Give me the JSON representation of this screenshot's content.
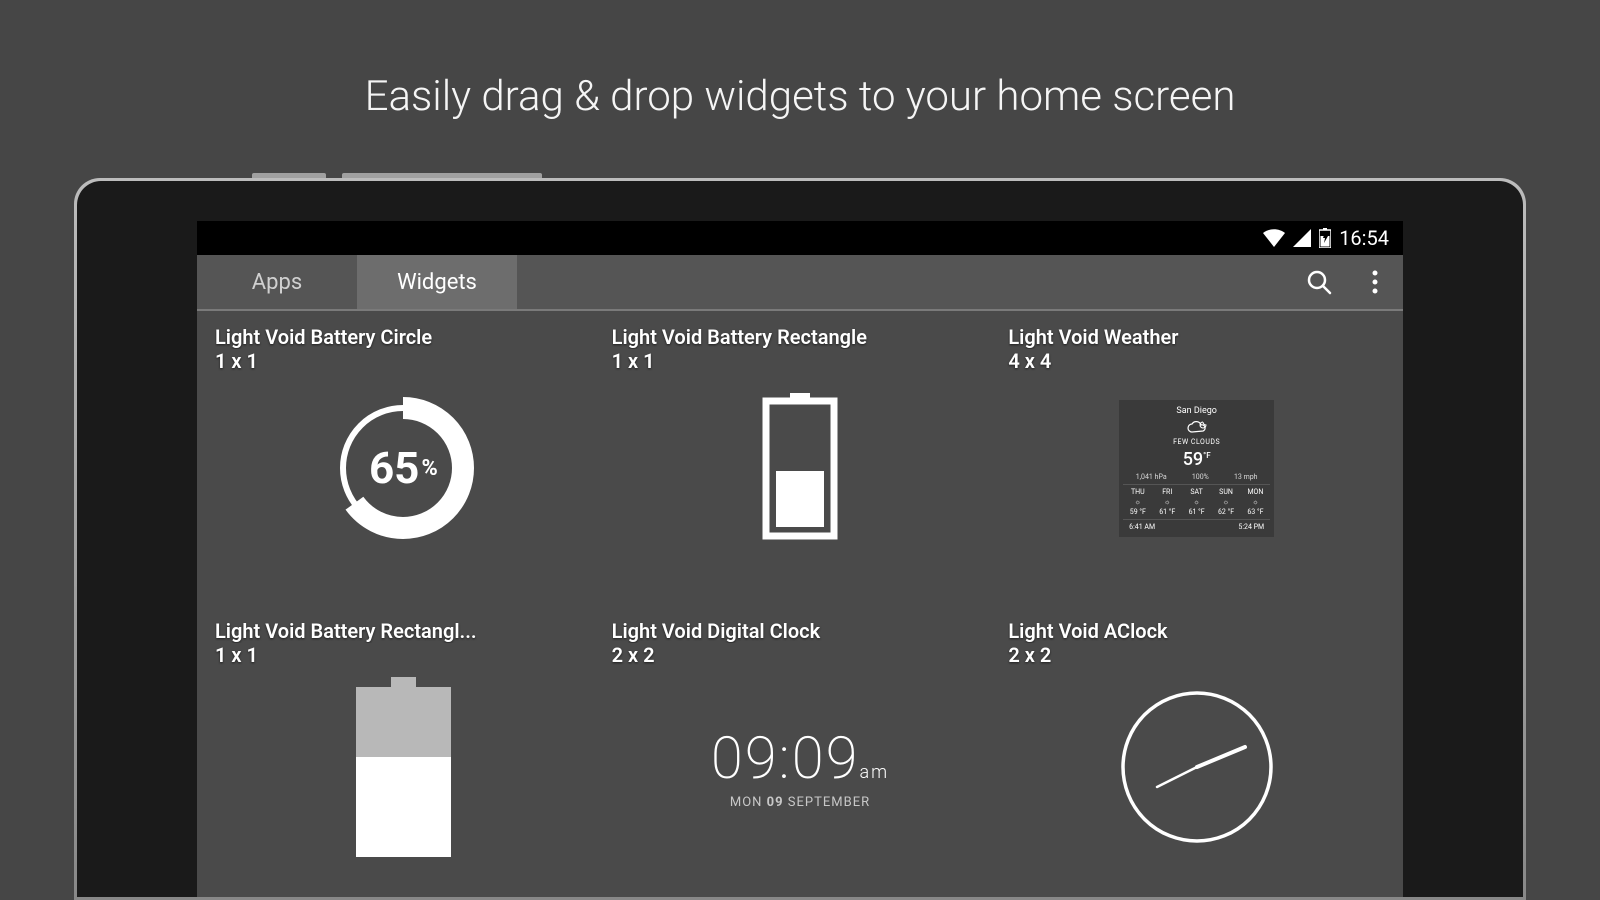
{
  "headline": "Easily drag & drop widgets to your home screen",
  "status_bar": {
    "time": "16:54"
  },
  "tabs": {
    "apps": "Apps",
    "widgets": "Widgets"
  },
  "widgets": [
    {
      "title": "Light Void Battery Circle",
      "size": "1 x 1",
      "type": "battery_circle",
      "value": "65",
      "unit": "%"
    },
    {
      "title": "Light Void Battery Rectangle",
      "size": "1 x 1",
      "type": "battery_rect_outline"
    },
    {
      "title": "Light Void Weather",
      "size": "4 x 4",
      "type": "weather",
      "city": "San Diego",
      "desc": "FEW CLOUDS",
      "temp": "59",
      "unit": "°F",
      "pressure": "1,041 hPa",
      "humidity": "100%",
      "wind": "13 mph",
      "days": [
        {
          "d": "THU",
          "t": "59 °F"
        },
        {
          "d": "FRI",
          "t": "61 °F"
        },
        {
          "d": "SAT",
          "t": "61 °F"
        },
        {
          "d": "SUN",
          "t": "62 °F"
        },
        {
          "d": "MON",
          "t": "63 °F"
        }
      ],
      "sunrise": "6:41 AM",
      "sunset": "5:24 PM"
    },
    {
      "title": "Light Void Battery Rectangl...",
      "size": "1 x 1",
      "type": "battery_rect_filled"
    },
    {
      "title": "Light Void Digital Clock",
      "size": "2 x 2",
      "type": "digital_clock",
      "time": "09:09",
      "ampm": "am",
      "date_pre": "MON ",
      "date_bold": "09",
      "date_post": " SEPTEMBER"
    },
    {
      "title": "Light Void AClock",
      "size": "2 x 2",
      "type": "analog_clock"
    }
  ]
}
